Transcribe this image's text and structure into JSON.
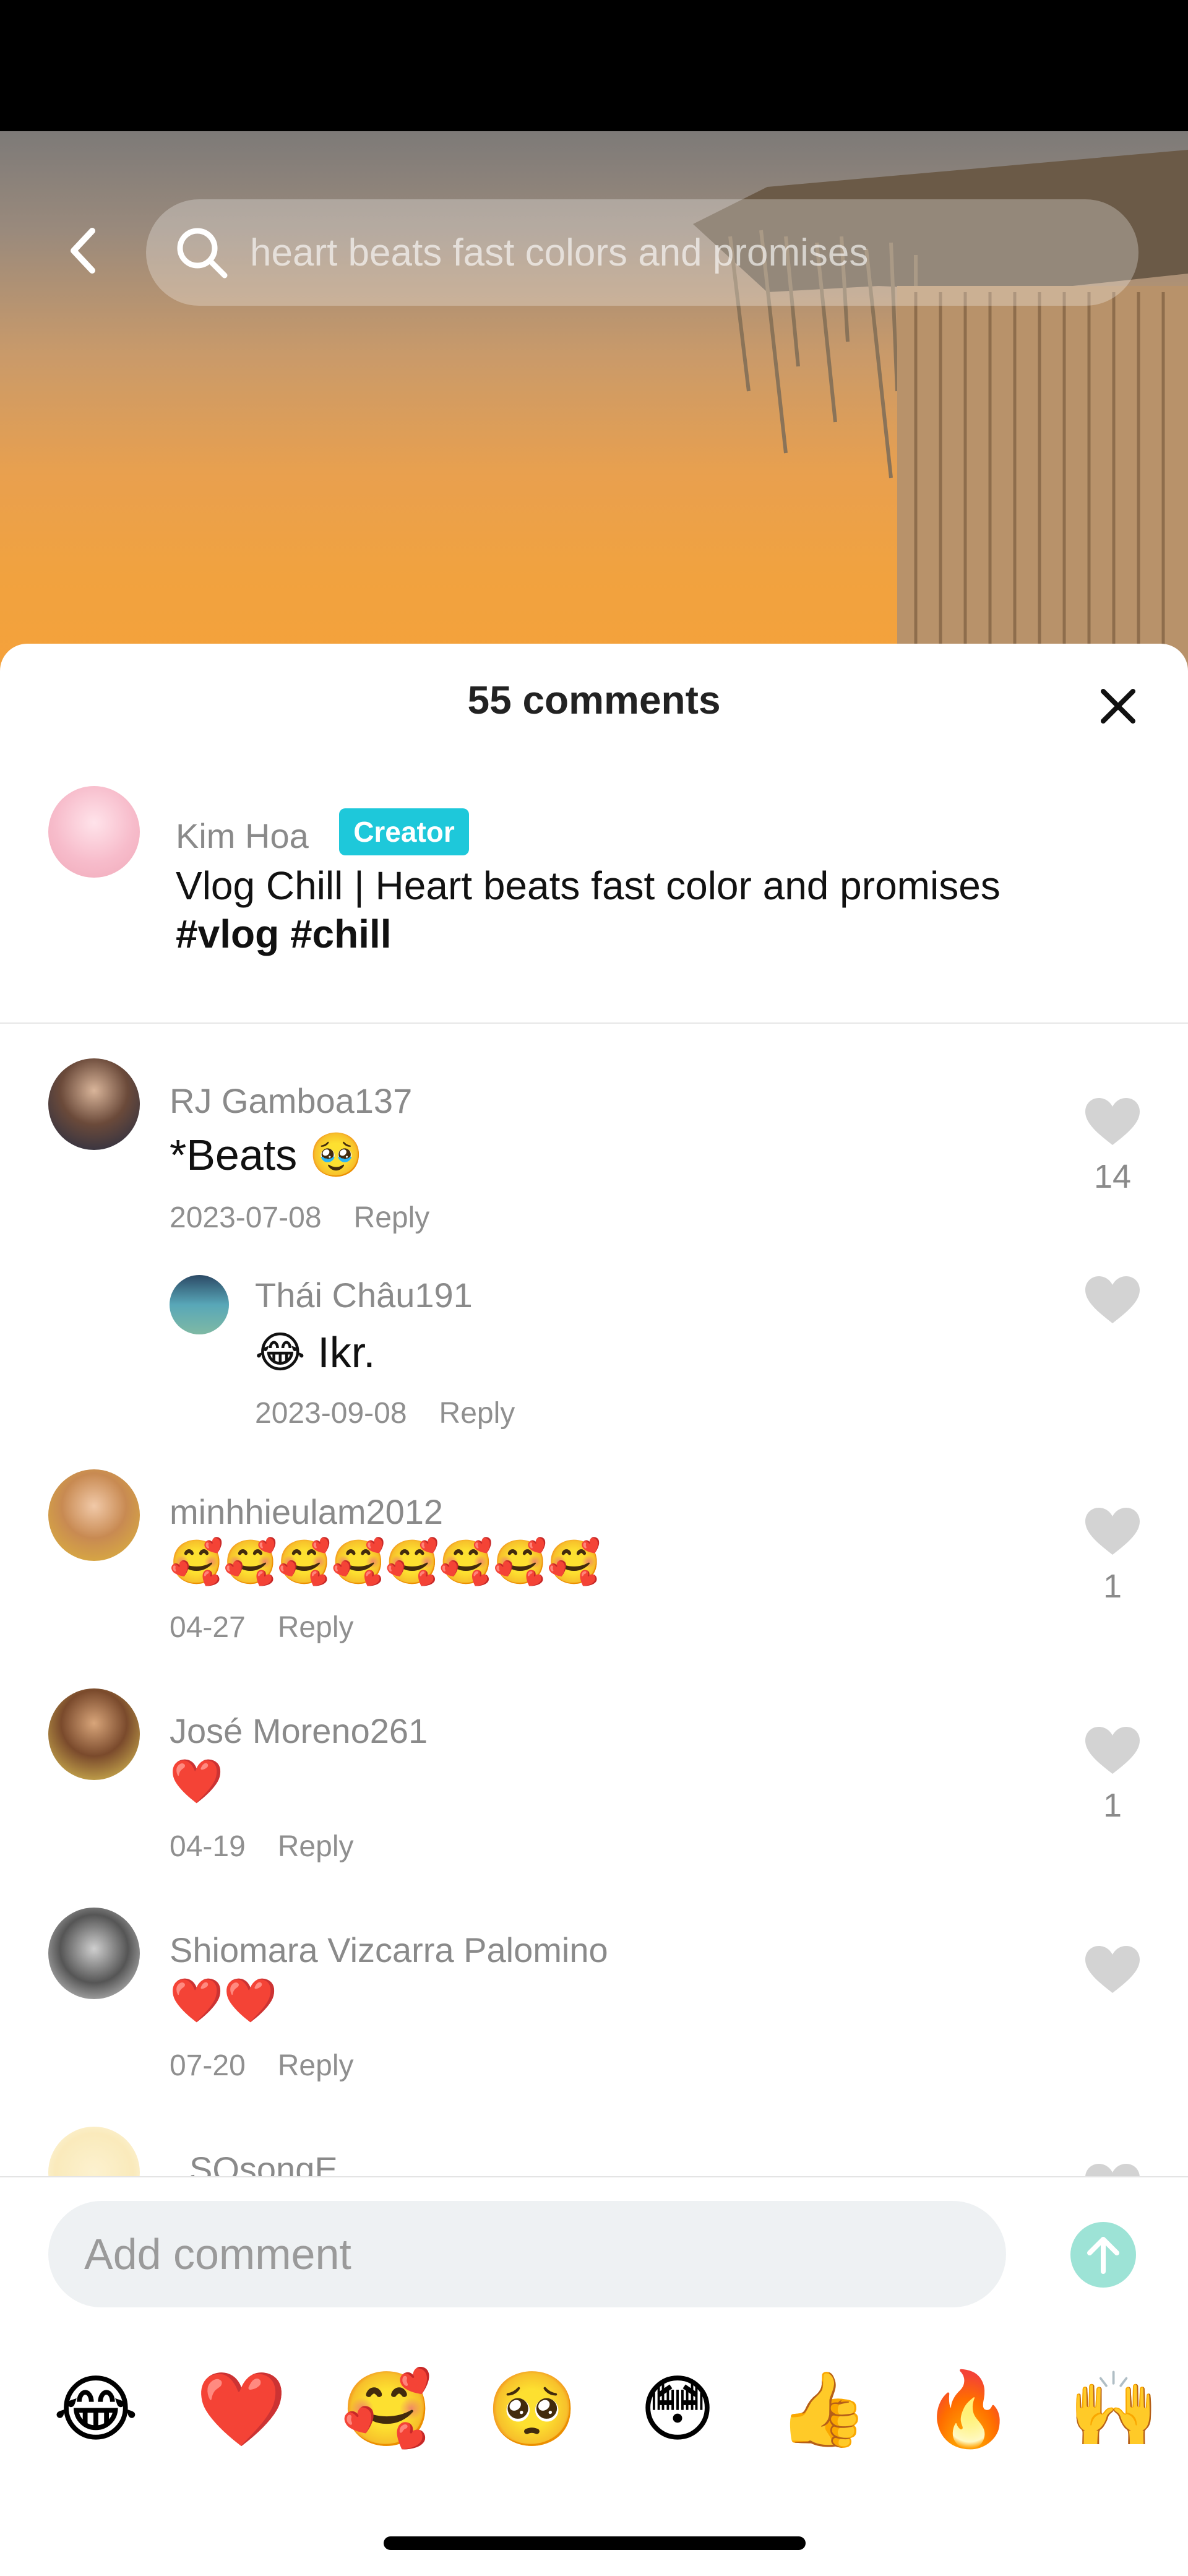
{
  "search": {
    "query": "heart beats fast colors and promises"
  },
  "sheet": {
    "title": "55 comments"
  },
  "caption": {
    "author": "Kim Hoa",
    "badge": "Creator",
    "text_plain": "Vlog Chill | Heart beats fast color and promises ",
    "hashtags": "#vlog #chill"
  },
  "comments": [
    {
      "user": "RJ Gamboa137",
      "text": "*Beats 🥹",
      "date": "2023-07-08",
      "reply_label": "Reply",
      "likes": "14"
    },
    {
      "user": "Thái Châu191",
      "text": "😂 Ikr.",
      "date": "2023-09-08",
      "reply_label": "Reply",
      "likes": ""
    },
    {
      "user": "minhhieulam2012",
      "text": "🥰🥰🥰🥰🥰🥰🥰🥰",
      "date": "04-27",
      "reply_label": "Reply",
      "likes": "1"
    },
    {
      "user": "José Moreno261",
      "text": "❤️",
      "date": "04-19",
      "reply_label": "Reply",
      "likes": "1"
    },
    {
      "user": "Shiomara Vizcarra Palomino",
      "text": "❤️❤️",
      "date": "07-20",
      "reply_label": "Reply",
      "likes": ""
    },
    {
      "user": "SOsongE",
      "text": "",
      "date": "",
      "reply_label": "",
      "likes": ""
    }
  ],
  "input": {
    "placeholder": "Add comment"
  },
  "emoji_bar": [
    "😂",
    "❤️",
    "🥰",
    "🥺",
    "😳",
    "👍",
    "🔥",
    "🙌"
  ],
  "colors": {
    "creator_badge": "#1ec8da",
    "send_button": "#9de3d6",
    "sunset": "#f1a23f"
  },
  "icons": [
    "back-arrow-icon",
    "search-icon",
    "close-icon",
    "heart-icon",
    "send-arrow-icon"
  ]
}
